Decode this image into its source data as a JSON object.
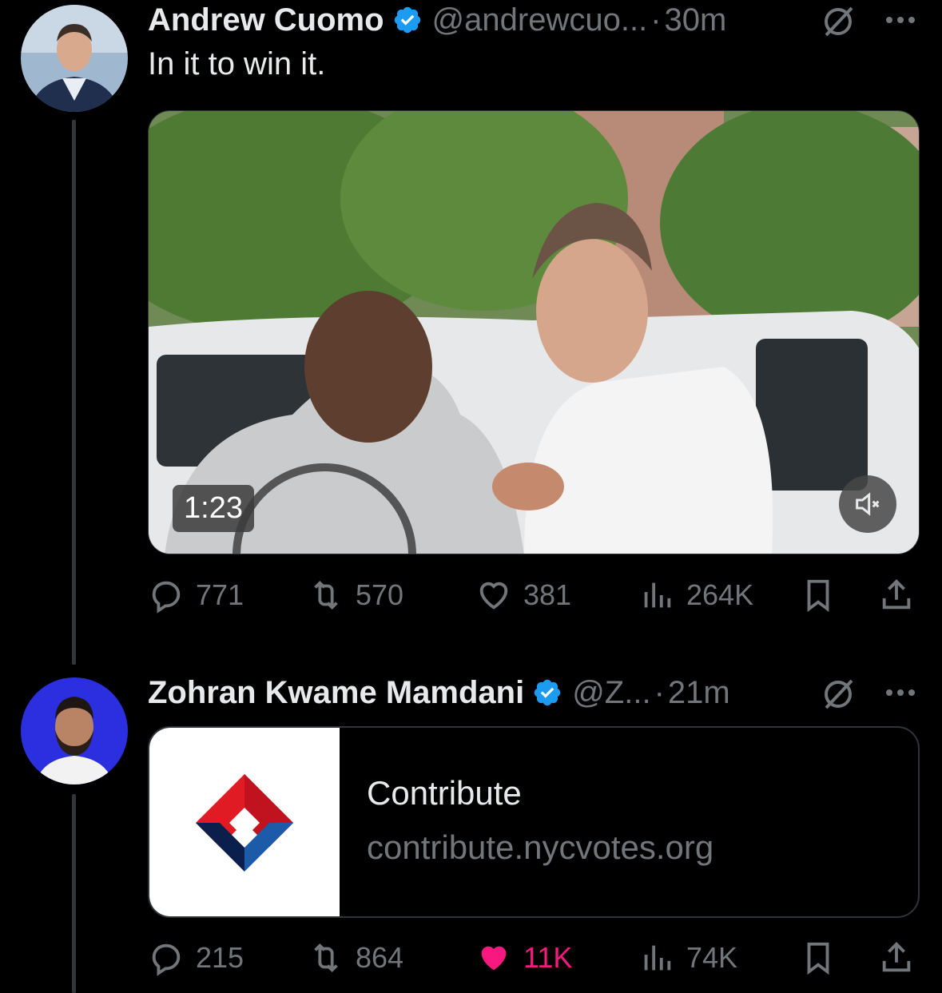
{
  "tweets": [
    {
      "name": "Andrew Cuomo",
      "handle": "@andrewcuo...",
      "time": "30m",
      "text": "In it to win it.",
      "video_duration": "1:23",
      "stats": {
        "replies": "771",
        "reposts": "570",
        "likes": "381",
        "views": "264K"
      }
    },
    {
      "name": "Zohran Kwame Mamdani",
      "handle": "@Z...",
      "time": "21m",
      "card": {
        "title": "Contribute",
        "domain": "contribute.nycvotes.org"
      },
      "stats": {
        "replies": "215",
        "reposts": "864",
        "likes": "11K",
        "views": "74K"
      }
    }
  ],
  "separator": "·",
  "colors": {
    "background": "#000000",
    "verified": "#1d9bf0",
    "muted_text": "#71767b",
    "like_active": "#f91880"
  }
}
